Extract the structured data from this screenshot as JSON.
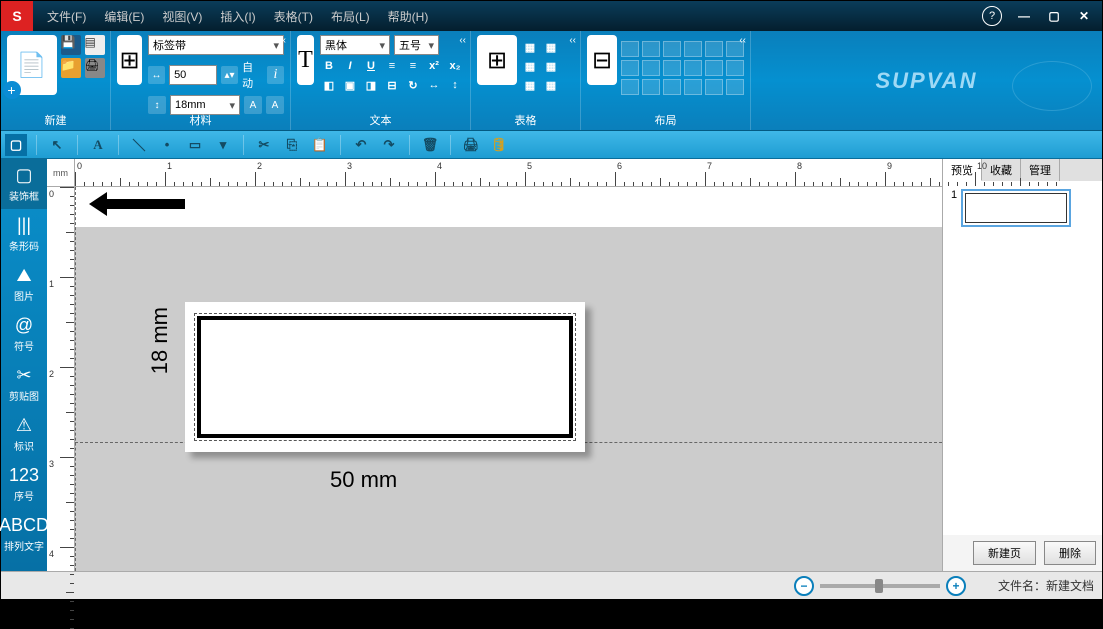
{
  "menus": {
    "file": "文件(F)",
    "edit": "编辑(E)",
    "view": "视图(V)",
    "insert": "插入(I)",
    "table": "表格(T)",
    "layout": "布局(L)",
    "help": "帮助(H)"
  },
  "ribbon": {
    "new_label": "新建",
    "material_label": "材料",
    "text_label": "文本",
    "table_label": "表格",
    "layout_label": "布局",
    "combo1": "标签带",
    "width_val": "50",
    "auto": "自动",
    "height_combo": "18mm",
    "font": "黑体",
    "fontsize": "五号",
    "brand": "SUPVAN"
  },
  "leftsb": [
    {
      "icon": "▢",
      "label": "装饰框"
    },
    {
      "icon": "|||",
      "label": "条形码"
    },
    {
      "icon": "⛰",
      "label": "图片"
    },
    {
      "icon": "@",
      "label": "符号"
    },
    {
      "icon": "✂",
      "label": "剪贴图"
    },
    {
      "icon": "⚠",
      "label": "标识"
    },
    {
      "icon": "123",
      "label": "序号"
    },
    {
      "icon": "ABCD",
      "label": "排列文字"
    }
  ],
  "ruler_corner": "mm",
  "canvas": {
    "dim_h": "50 mm",
    "dim_v": "18 mm"
  },
  "rightp": {
    "tabs": {
      "preview": "预览",
      "favorite": "收藏",
      "manage": "管理"
    },
    "thumb_n": "1",
    "newpage": "新建页",
    "delete": "删除"
  },
  "status": {
    "fname_lbl": "文件名：",
    "fname": "新建文档"
  }
}
